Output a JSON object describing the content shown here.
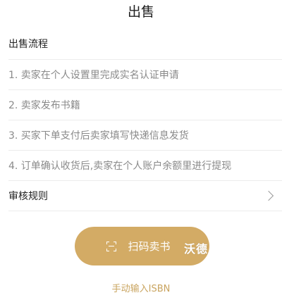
{
  "nav": {
    "title": "出售"
  },
  "process": {
    "header": "出售流程",
    "steps": [
      "1. 卖家在个人设置里完成实名认证申请",
      "2. 卖家发布书籍",
      "3. 买家下单支付后卖家填写快递信息发货",
      "4. 订单确认收货后,卖家在个人账户余额里进行提现"
    ]
  },
  "audit": {
    "label": "审核规则",
    "icon": "chevron-right-icon"
  },
  "scan_button": {
    "label": "扫码卖书",
    "icon": "scan-icon",
    "overlay": "沃德"
  },
  "manual_link": {
    "label": "手动输入ISBN"
  },
  "colors": {
    "accent": "#d3ab65",
    "link": "#c9a45f",
    "divider": "#ececec"
  }
}
